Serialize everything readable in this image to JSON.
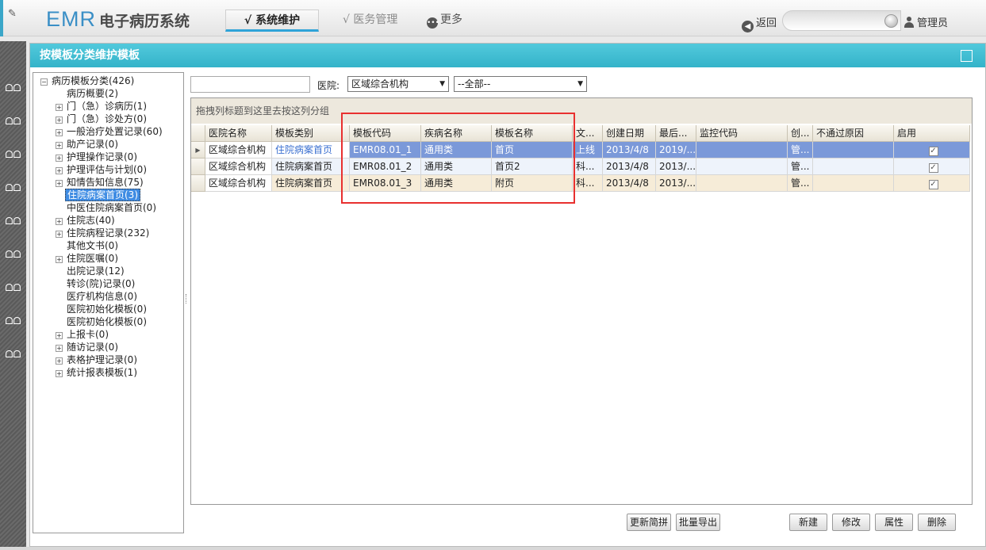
{
  "app": {
    "logo_en": "EMR",
    "logo_cn": "电子病历系统",
    "nav": [
      {
        "label": "√ 系统维护",
        "active": true
      },
      {
        "label": "√ 医务管理",
        "active": false
      },
      {
        "label": "更多",
        "active": false,
        "icon": "dots-circle-icon"
      }
    ],
    "back_label": "返回",
    "user_label": "管理员"
  },
  "panel": {
    "title": "按模板分类维护模板"
  },
  "tree": {
    "items": [
      {
        "label": "病历模板分类(426)",
        "expander": "−",
        "level": 0
      },
      {
        "label": "病历概要(2)",
        "expander": "",
        "level": 1
      },
      {
        "label": "门（急）诊病历(1)",
        "expander": "+",
        "level": 1
      },
      {
        "label": "门（急）诊处方(0)",
        "expander": "+",
        "level": 1
      },
      {
        "label": "一般治疗处置记录(60)",
        "expander": "+",
        "level": 1
      },
      {
        "label": "助产记录(0)",
        "expander": "+",
        "level": 1
      },
      {
        "label": "护理操作记录(0)",
        "expander": "+",
        "level": 1
      },
      {
        "label": "护理评估与计划(0)",
        "expander": "+",
        "level": 1
      },
      {
        "label": "知情告知信息(75)",
        "expander": "+",
        "level": 1
      },
      {
        "label": "住院病案首页(3)",
        "expander": "",
        "level": 1,
        "selected": true
      },
      {
        "label": "中医住院病案首页(0)",
        "expander": "",
        "level": 1
      },
      {
        "label": "住院志(40)",
        "expander": "+",
        "level": 1
      },
      {
        "label": "住院病程记录(232)",
        "expander": "+",
        "level": 1
      },
      {
        "label": "其他文书(0)",
        "expander": "",
        "level": 1
      },
      {
        "label": "住院医嘱(0)",
        "expander": "+",
        "level": 1
      },
      {
        "label": "出院记录(12)",
        "expander": "",
        "level": 1
      },
      {
        "label": "转诊(院)记录(0)",
        "expander": "",
        "level": 1
      },
      {
        "label": "医疗机构信息(0)",
        "expander": "",
        "level": 1
      },
      {
        "label": "医院初始化模板(0)",
        "expander": "",
        "level": 1
      },
      {
        "label": "医院初始化模板(0)",
        "expander": "",
        "level": 1
      },
      {
        "label": "上报卡(0)",
        "expander": "+",
        "level": 1
      },
      {
        "label": "随访记录(0)",
        "expander": "+",
        "level": 1
      },
      {
        "label": "表格护理记录(0)",
        "expander": "+",
        "level": 1
      },
      {
        "label": "统计报表模板(1)",
        "expander": "+",
        "level": 1
      }
    ]
  },
  "toolbar": {
    "search_value": "",
    "hospital_label": "医院:",
    "hospital_select": "区域综合机构",
    "scope_select": "--全部--"
  },
  "grid": {
    "group_hint": "拖拽列标题到这里去按这列分组",
    "columns": [
      "医院名称",
      "模板类别",
      "模板代码",
      "疾病名称",
      "模板名称",
      "文...",
      "创建日期",
      "最后...",
      "监控代码",
      "创...",
      "不通过原因",
      "启用"
    ],
    "rows": [
      [
        "区域综合机构",
        "住院病案首页",
        "EMR08.01_1",
        "通用类",
        "首页",
        "上线",
        "2013/4/8",
        "2019/...",
        "",
        "管...",
        "",
        true
      ],
      [
        "区域综合机构",
        "住院病案首页",
        "EMR08.01_2",
        "通用类",
        "首页2",
        "科...",
        "2013/4/8",
        "2013/...",
        "",
        "管...",
        "",
        true
      ],
      [
        "区域综合机构",
        "住院病案首页",
        "EMR08.01_3",
        "通用类",
        "附页",
        "科...",
        "2013/4/8",
        "2013/...",
        "",
        "管...",
        "",
        true
      ]
    ],
    "checked_glyph": "✓"
  },
  "buttons": {
    "refresh_pinyin": "更新简拼",
    "batch_export": "批量导出",
    "new": "新建",
    "edit": "修改",
    "props": "属性",
    "delete": "删除"
  },
  "colors": {
    "accent": "#34b3c9",
    "selected_row": "#7b99d9",
    "highlight_box": "#e8302f"
  }
}
